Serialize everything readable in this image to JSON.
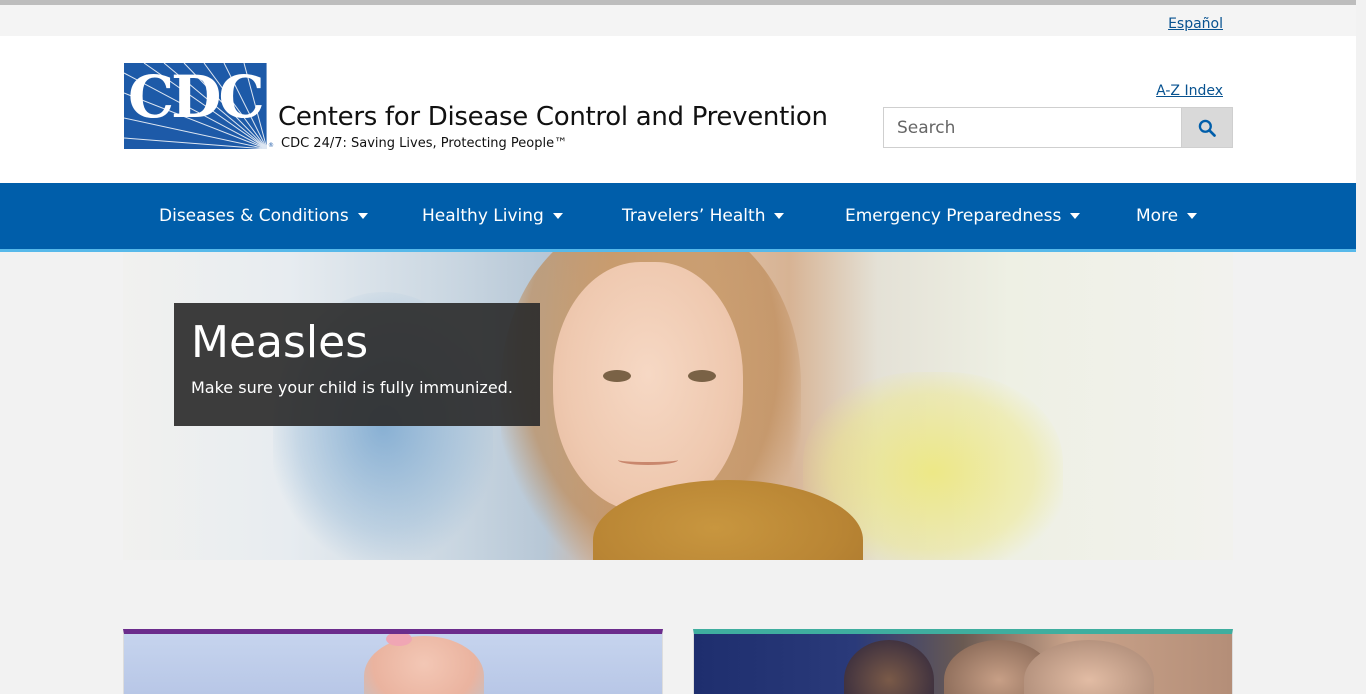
{
  "utility": {
    "espanol_label": "Español"
  },
  "header": {
    "logo_letters": "CDC",
    "logo_registered": "®",
    "org_name": "Centers for Disease Control and Prevention",
    "tagline": "CDC 24/7: Saving Lives, Protecting People™",
    "az_index_label": "A-Z Index",
    "search_placeholder": "Search"
  },
  "nav": {
    "items": [
      {
        "label": "Diseases & Conditions"
      },
      {
        "label": "Healthy Living"
      },
      {
        "label": "Travelers’ Health"
      },
      {
        "label": "Emergency Preparedness"
      },
      {
        "label": "More"
      }
    ]
  },
  "hero": {
    "title": "Measles",
    "subtitle": "Make sure your child is fully immunized."
  },
  "colors": {
    "brand_blue": "#005eaa",
    "logo_blue": "#1d5aa8",
    "link": "#075290",
    "nav_underline": "#57b9ea",
    "card1_accent": "#6b2c8c",
    "card2_accent": "#3fae9f"
  },
  "icons": {
    "search_button": "search-icon",
    "nav_dropdown": "caret-down-icon"
  }
}
